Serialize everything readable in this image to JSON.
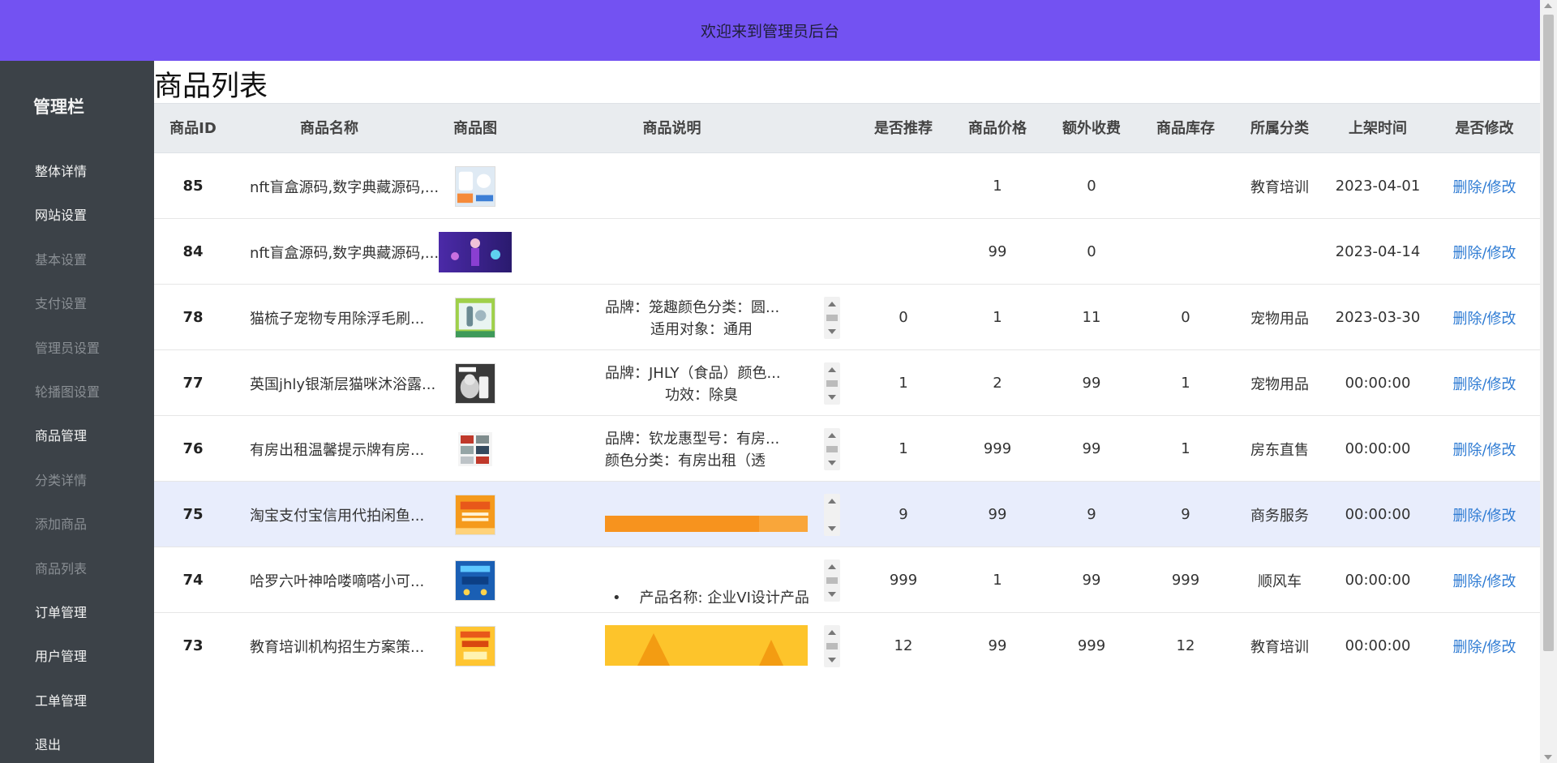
{
  "header": {
    "title": "欢迎来到管理员后台"
  },
  "sidebar": {
    "heading": "管理栏",
    "items": [
      {
        "label": "整体详情",
        "state": "active"
      },
      {
        "label": "网站设置",
        "state": "active"
      },
      {
        "label": "基本设置",
        "state": "muted"
      },
      {
        "label": "支付设置",
        "state": "muted"
      },
      {
        "label": "管理员设置",
        "state": "muted"
      },
      {
        "label": "轮播图设置",
        "state": "muted"
      },
      {
        "label": "商品管理",
        "state": "active"
      },
      {
        "label": "分类详情",
        "state": "muted"
      },
      {
        "label": "添加商品",
        "state": "muted"
      },
      {
        "label": "商品列表",
        "state": "muted"
      },
      {
        "label": "订单管理",
        "state": "active"
      },
      {
        "label": "用户管理",
        "state": "active"
      },
      {
        "label": "工单管理",
        "state": "active"
      },
      {
        "label": "退出",
        "state": "active"
      }
    ]
  },
  "page": {
    "title": "商品列表"
  },
  "table": {
    "headers": [
      "商品ID",
      "商品名称",
      "商品图",
      "商品说明",
      "是否推荐",
      "商品价格",
      "额外收费",
      "商品库存",
      "所属分类",
      "上架时间",
      "是否修改"
    ],
    "rows": [
      {
        "id": "85",
        "name": "nft盲盒源码,数字典藏源码,...",
        "image": "product-85-thumbnail",
        "desc1": "",
        "desc2": "",
        "recommend": "",
        "price": "1",
        "extra": "0",
        "stock": "",
        "category": "教育培训",
        "time": "2023-04-01",
        "action": "删除/修改"
      },
      {
        "id": "84",
        "name": "nft盲盒源码,数字典藏源码,...",
        "image": "product-84-thumbnail",
        "desc1": "",
        "desc2": "",
        "recommend": "",
        "price": "99",
        "extra": "0",
        "stock": "",
        "category": "",
        "time": "2023-04-14",
        "action": "删除/修改"
      },
      {
        "id": "78",
        "name": "猫梳子宠物专用除浮毛刷...",
        "image": "product-78-thumbnail",
        "desc1": "品牌：笼趣颜色分类：圆...",
        "desc2": "适用对象：通用",
        "recommend": "0",
        "price": "1",
        "extra": "11",
        "stock": "0",
        "category": "宠物用品",
        "time": "2023-03-30",
        "action": "删除/修改"
      },
      {
        "id": "77",
        "name": "英国jhly银渐层猫咪沐浴露...",
        "image": "product-77-thumbnail",
        "desc1": "品牌：JHLY（食品）颜色...",
        "desc2": "功效：除臭",
        "recommend": "1",
        "price": "2",
        "extra": "99",
        "stock": "1",
        "category": "宠物用品",
        "time": "00:00:00",
        "action": "删除/修改"
      },
      {
        "id": "76",
        "name": "有房出租温馨提示牌有房...",
        "image": "product-76-thumbnail",
        "desc1": "品牌：钦龙惠型号：有房...",
        "desc2": "颜色分类：有房出租（透",
        "recommend": "1",
        "price": "999",
        "extra": "99",
        "stock": "1",
        "category": "房东直售",
        "time": "00:00:00",
        "action": "删除/修改"
      },
      {
        "id": "75",
        "name": "淘宝支付宝信用代拍闲鱼...",
        "image": "product-75-thumbnail",
        "desc1": "",
        "desc2": "",
        "recommend": "9",
        "price": "99",
        "extra": "9",
        "stock": "9",
        "category": "商务服务",
        "time": "00:00:00",
        "action": "删除/修改"
      },
      {
        "id": "74",
        "name": "哈罗六叶神哈喽嘀嗒小可...",
        "image": "product-74-thumbnail",
        "desc1": "",
        "desc2": "产品名称: 企业VI设计产品",
        "recommend": "999",
        "price": "1",
        "extra": "99",
        "stock": "999",
        "category": "顺风车",
        "time": "00:00:00",
        "action": "删除/修改"
      },
      {
        "id": "73",
        "name": "教育培训机构招生方案策...",
        "image": "product-73-thumbnail",
        "desc1": "",
        "desc2": "",
        "recommend": "12",
        "price": "99",
        "extra": "999",
        "stock": "12",
        "category": "教育培训",
        "time": "00:00:00",
        "action": "删除/修改"
      }
    ]
  },
  "colors": {
    "header_bg": "#7352f2",
    "sidebar_bg": "#3c4248",
    "link": "#2e7bd3",
    "highlight_row": "#e8edfc"
  }
}
